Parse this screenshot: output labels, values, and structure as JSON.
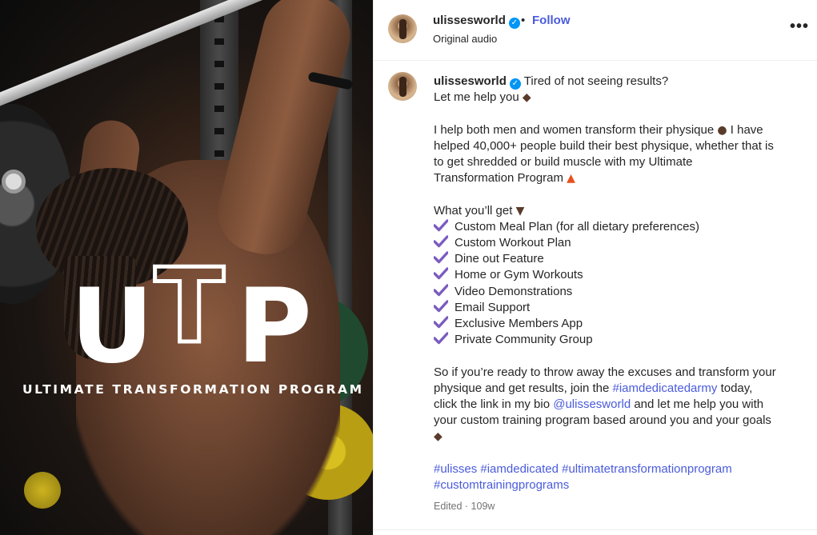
{
  "media": {
    "logo_letters": [
      "U",
      "T",
      "P"
    ],
    "caption": "ULTIMATE TRANSFORMATION PROGRAM"
  },
  "header": {
    "username": "ulissesworld",
    "separator": "•",
    "follow_label": "Follow",
    "audio_label": "Original audio",
    "more_icon": "more-options-icon"
  },
  "post": {
    "username": "ulissesworld",
    "intro_1": "Tired of not seeing results?",
    "intro_2": "Let me help you",
    "para1_l1": "I help both men and women transform their physique",
    "para1_l1b": "I have",
    "para1_l2": "helped 40,000+ people build their best physique, whether that is",
    "para1_l3": "to get shredded or build muscle with my Ultimate",
    "para1_l4": "Transformation Program",
    "list_title": "What you’ll get",
    "features": [
      "Custom Meal Plan (for all dietary preferences)",
      "Custom Workout Plan",
      "Dine out Feature",
      "Home or Gym Workouts",
      "Video Demonstrations",
      "Email Support",
      "Exclusive Members App",
      "Private Community Group"
    ],
    "para2_l1": "So if you’re ready to throw away the excuses and transform your",
    "para2_l2a": "physique and get results, join the",
    "para2_hashtag": "#iamdedicatedarmy",
    "para2_l2b": "today,",
    "para2_l3a": "click the link in my bio",
    "para2_mention": "@ulissesworld",
    "para2_l3b": "and let me help you with",
    "para2_l4": "your custom training program based around you and your goals",
    "hashtags_l1": [
      "#ulisses",
      "#iamdedicated",
      "#ultimatetransformationprogram"
    ],
    "hashtags_l2": [
      "#customtrainingprograms"
    ],
    "edited": "Edited · 109w"
  },
  "colors": {
    "link": "#4a5bdc",
    "verified": "#0095f6",
    "check": "#7c5cbf",
    "muted": "#737373"
  }
}
